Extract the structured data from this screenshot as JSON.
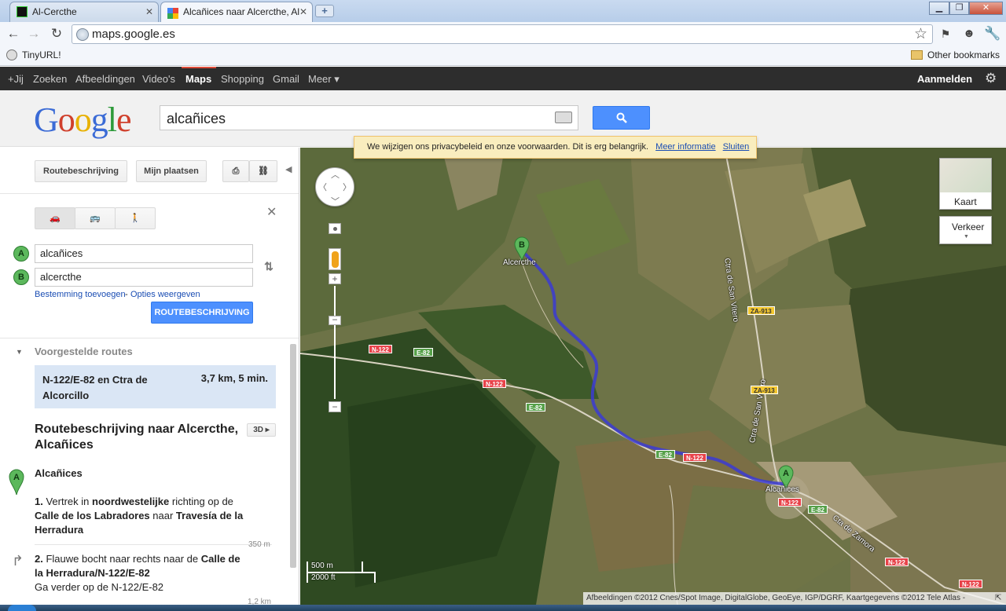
{
  "browser": {
    "tabs": [
      {
        "title": "Al-Cercthe",
        "active": false
      },
      {
        "title": "Alcañices naar Alcercthe, Al",
        "active": true
      }
    ],
    "url": "maps.google.es",
    "bookmark": "TinyURL!",
    "other_bookmarks": "Other bookmarks"
  },
  "gbar": {
    "items": [
      "+Jij",
      "Zoeken",
      "Afbeeldingen",
      "Video's",
      "Maps",
      "Shopping",
      "Gmail",
      "Meer ▾"
    ],
    "active": "Maps",
    "signin": "Aanmelden"
  },
  "header": {
    "logo": "Google",
    "search_value": "alcañices"
  },
  "panel": {
    "route_button": "Routebeschrijving",
    "myplaces_button": "Mijn plaatsen",
    "origin_label": "A",
    "origin": "alcañices",
    "destination_label": "B",
    "destination": "alcercthe",
    "add_destination": "Bestemming toevoegen",
    "separator": "-",
    "show_options": "Opties weergeven",
    "submit": "ROUTEBESCHRIJVING",
    "suggested_heading": "Voorgestelde routes",
    "suggested_route": {
      "name": "N-122/E-82 en Ctra de Alcorcillo",
      "summary": "3,7 km, 5 min."
    },
    "directions_title": "Routebeschrijving naar Alcercthe, Alcañices",
    "view_3d": "3D",
    "start_place": "Alcañices",
    "steps": [
      {
        "num": "1.",
        "text_parts": [
          "Vertrek in ",
          "noordwestelijke",
          " richting op de ",
          "Calle de los Labradores",
          " naar ",
          "Travesía de la Herradura"
        ],
        "distance": "350 m"
      },
      {
        "num": "2.",
        "text_parts": [
          "Flauwe bocht naar rechts naar de ",
          "Calle de la Herradura/N-122/E-82"
        ],
        "sub": "Ga verder op de N-122/E-82",
        "distance": "1,2 km"
      }
    ]
  },
  "map": {
    "privacy_text": "We wijzigen ons privacybeleid en onze voorwaarden. Dit is erg belangrijk.",
    "privacy_more": "Meer informatie",
    "privacy_close": "Sluiten",
    "map_type": "Kaart",
    "traffic": "Verkeer",
    "labels": {
      "place_b": "Alcercthe",
      "place_a": "Alcañices",
      "road_san_vitero_1": "Ctra de San Vitero",
      "road_san_vitero_2": "Ctra de San Vitero",
      "road_zamora": "Cta de Zamora",
      "pin_a": "A",
      "pin_b": "B"
    },
    "shields": {
      "n122": "N-122",
      "e82": "E-82",
      "za913": "ZA-913"
    },
    "scale_m": "500 m",
    "scale_ft": "2000 ft",
    "attribution": "Afbeeldingen ©2012 Cnes/Spot Image, DigitalGlobe, GeoEye, IGP/DGRF, Kaartgegevens ©2012 Tele Atlas -"
  },
  "colors": {
    "route": "#3b3bd4",
    "gbar": "#2d2d2d",
    "search_blue": "#4d90fe",
    "pin_green": "#5cb85c"
  }
}
